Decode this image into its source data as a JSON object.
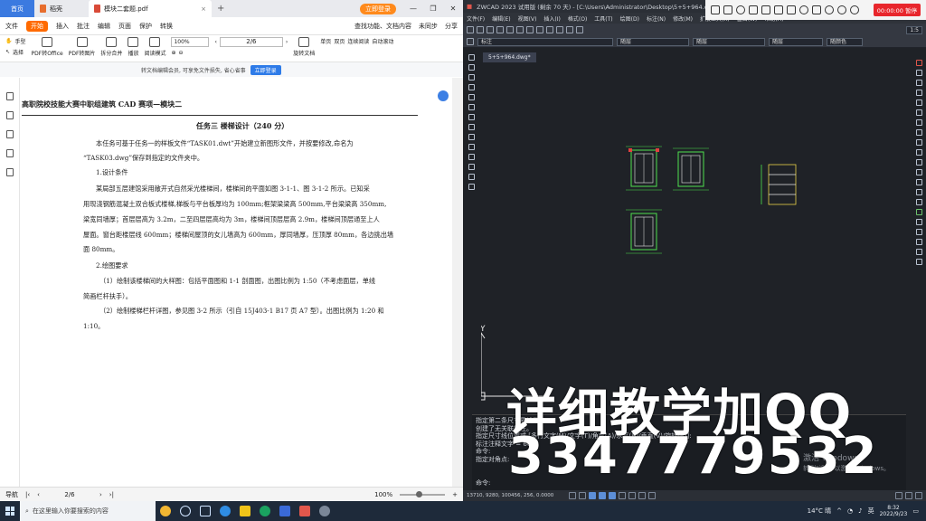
{
  "pdf": {
    "tabs": [
      {
        "label": "首页"
      },
      {
        "label": "稻壳"
      },
      {
        "label": "模块二套题.pdf"
      }
    ],
    "login_button": "立即登录",
    "menu": [
      "文件",
      "开始",
      "插入",
      "批注",
      "编辑",
      "页面",
      "保护",
      "转换"
    ],
    "menu_right": [
      "查找功能、文档内容",
      "未同步",
      "分享"
    ],
    "ribbon": {
      "hand": "手型",
      "select": "选择",
      "pdf_to_office": "PDF转Office",
      "pdf_to_image": "PDF转图片",
      "split_merge": "拆分合并",
      "play": "播放",
      "read_mode": "阅读模式",
      "zoom": "100%",
      "page": "2/6",
      "rotate": "旋转文档",
      "single": "单页",
      "double": "双页",
      "continuous": "连续阅读",
      "auto_scroll": "自动滚动"
    },
    "notice": {
      "text": "转文档编辑会员, 可享免文件损失, 省心省事",
      "button": "立即登录"
    },
    "document": {
      "header": "高职院校技能大赛中职组建筑 CAD 赛项—模块二",
      "title": "任务三    楼梯设计（240 分）",
      "lines": [
        "本任务可基于任务一的样板文件“TASK01.dwt”开始建立新图形文件，并按要修改,命名为",
        "“TASK03.dwg”保存到指定的文件夹中。",
        "1.设计条件",
        "某局部五层建馆采用敞开式自然采光楼梯间，楼梯间的平面如图 3-1-1、图 3-1-2 所示。已知采",
        "用现浇钢筋混凝土双合板式楼梯,梯板与平台板厚均为 100mm;框架梁梁高 500mm,平台梁梁高 350mm,",
        "梁宽同墙厚；首层层高为 3.2m，二至四层层高均为 3m，楼梯间顶层层高 2.9m，楼梯间顶层通至上人",
        "屋面。窗台距楼层线 600mm；楼梯间屋顶的女儿墙高为 600mm，厚同墙厚，压顶厚 80mm，各边挑出墙",
        "面 80mm。",
        "2.绘图要求",
        "（1）绘制该楼梯间的大样图：包括平面图和 1-1 剖面图，出图比例为 1:50（不考虑面层，单线",
        "简画栏杆扶手）。",
        "（2）绘制楼梯栏杆详图，参见图 3-2 所示（引自 15J403-1 B17 页 A7 型）。出图比例为 1:20 和",
        "1:10。"
      ]
    },
    "status": {
      "nav": "导航",
      "page": "2/6",
      "zoom": "100%"
    }
  },
  "cad": {
    "title": "ZWCAD 2023 试用版 (剩余 70 天) - [C:\\Users\\Administrator\\Desktop\\5+5+964.dwg]",
    "menu": [
      "文件(F)",
      "编辑(E)",
      "视图(V)",
      "插入(I)",
      "格式(O)",
      "工具(T)",
      "绘图(D)",
      "标注(N)",
      "修改(M)",
      "扩展工具(X)",
      "窗口(W)",
      "帮助(H)",
      "APP+"
    ],
    "layer": "标注",
    "linetype1": "随层",
    "linetype2": "随层",
    "linetype3": "随层",
    "color": "随颜色",
    "scale": "1:5",
    "doc_tab": "5+5+964.dwg*",
    "command_lines": [
      "指定第二条尺寸界线原点:",
      "创建了无关联标注。",
      "指定尺寸线位置或 [多行文字(M)/文字(T)/角度(A)/水平(H)/垂直(V)/旋转(R)]:",
      "标注注释文字 = 600",
      "命令:",
      "指定对角点:"
    ],
    "command_prompt": "命令:",
    "coords": "13710, 9280, 100456, 256, 0.0000",
    "activate_watermark": [
      "激活 Windows",
      "转到\"设置\"以激活 Windows。"
    ]
  },
  "recorder": {
    "time": "00:00:00 暂停"
  },
  "overlay": {
    "line1": "详细教学加QQ",
    "line2": "3347779532"
  },
  "taskbar": {
    "search_placeholder": "在这里输入你要搜索的内容",
    "weather": "14°C 晴",
    "ime": "英",
    "time": "8:32",
    "date": "2022/9/23"
  }
}
